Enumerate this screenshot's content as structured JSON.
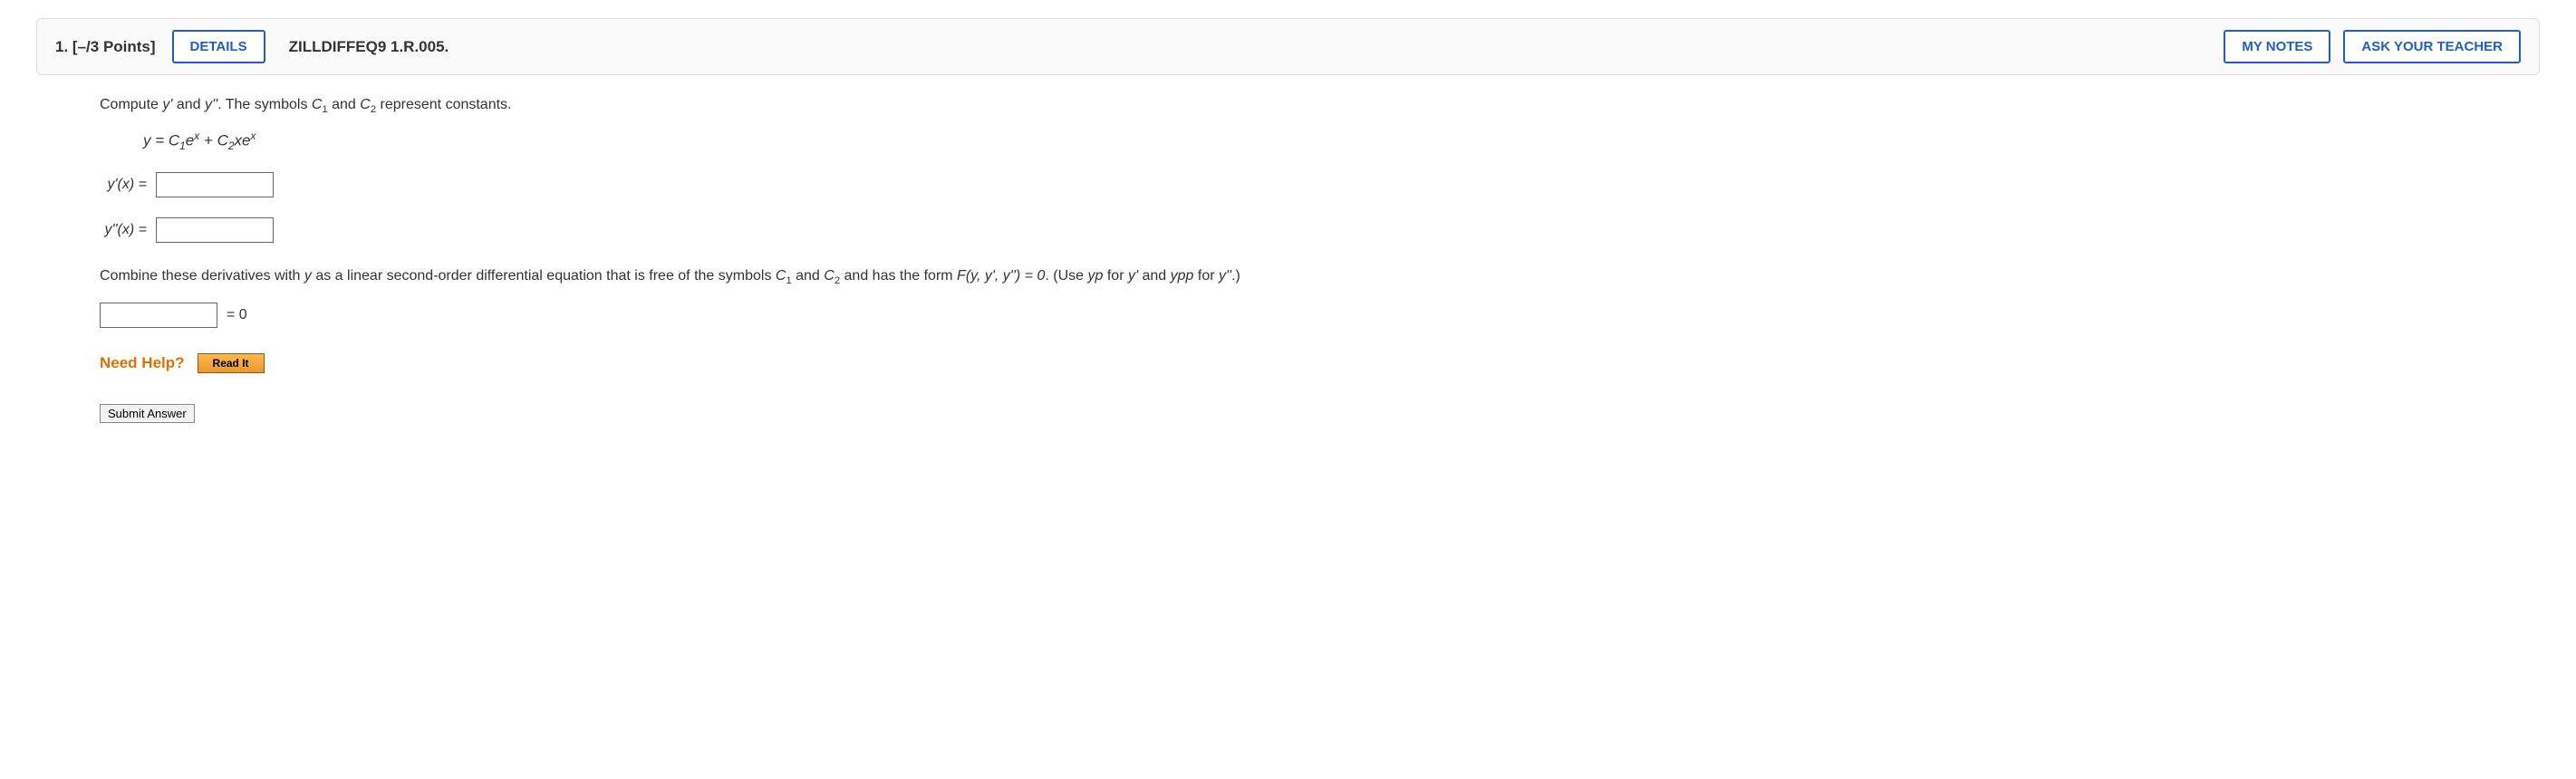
{
  "header": {
    "number": "1.",
    "points": "[–/3 Points]",
    "details_label": "DETAILS",
    "code": "ZILLDIFFEQ9 1.R.005.",
    "my_notes": "MY NOTES",
    "ask_teacher": "ASK YOUR TEACHER"
  },
  "body": {
    "instruction_pre": "Compute ",
    "instruction_mid1": " and ",
    "instruction_mid2": ". The symbols ",
    "instruction_c1": "C",
    "instruction_c2": "C",
    "instruction_and": " and ",
    "instruction_end": " represent constants.",
    "yprime": "y'",
    "ydprime": "y''",
    "eq_y": "y = C",
    "eq_ex": "e",
    "eq_plus": " + C",
    "eq_xe": "xe",
    "label_yp": "y'(x)  =",
    "label_ypp": "y''(x)  =",
    "instruction2_a": "Combine these derivatives with ",
    "instruction2_y": "y",
    "instruction2_b": " as a linear second-order differential equation that is free of the symbols ",
    "instruction2_c": " and ",
    "instruction2_d": " and has the form ",
    "instruction2_F": "F(y, y', y'') = 0",
    "instruction2_e": ". (Use ",
    "instruction2_yp": "yp",
    "instruction2_f": " for ",
    "instruction2_g": " and ",
    "instruction2_ypp": "ypp",
    "instruction2_h": " for ",
    "instruction2_i": ".)",
    "equals_zero": " =  0",
    "need_help": "Need Help?",
    "read_it": "Read It",
    "submit": "Submit Answer"
  }
}
